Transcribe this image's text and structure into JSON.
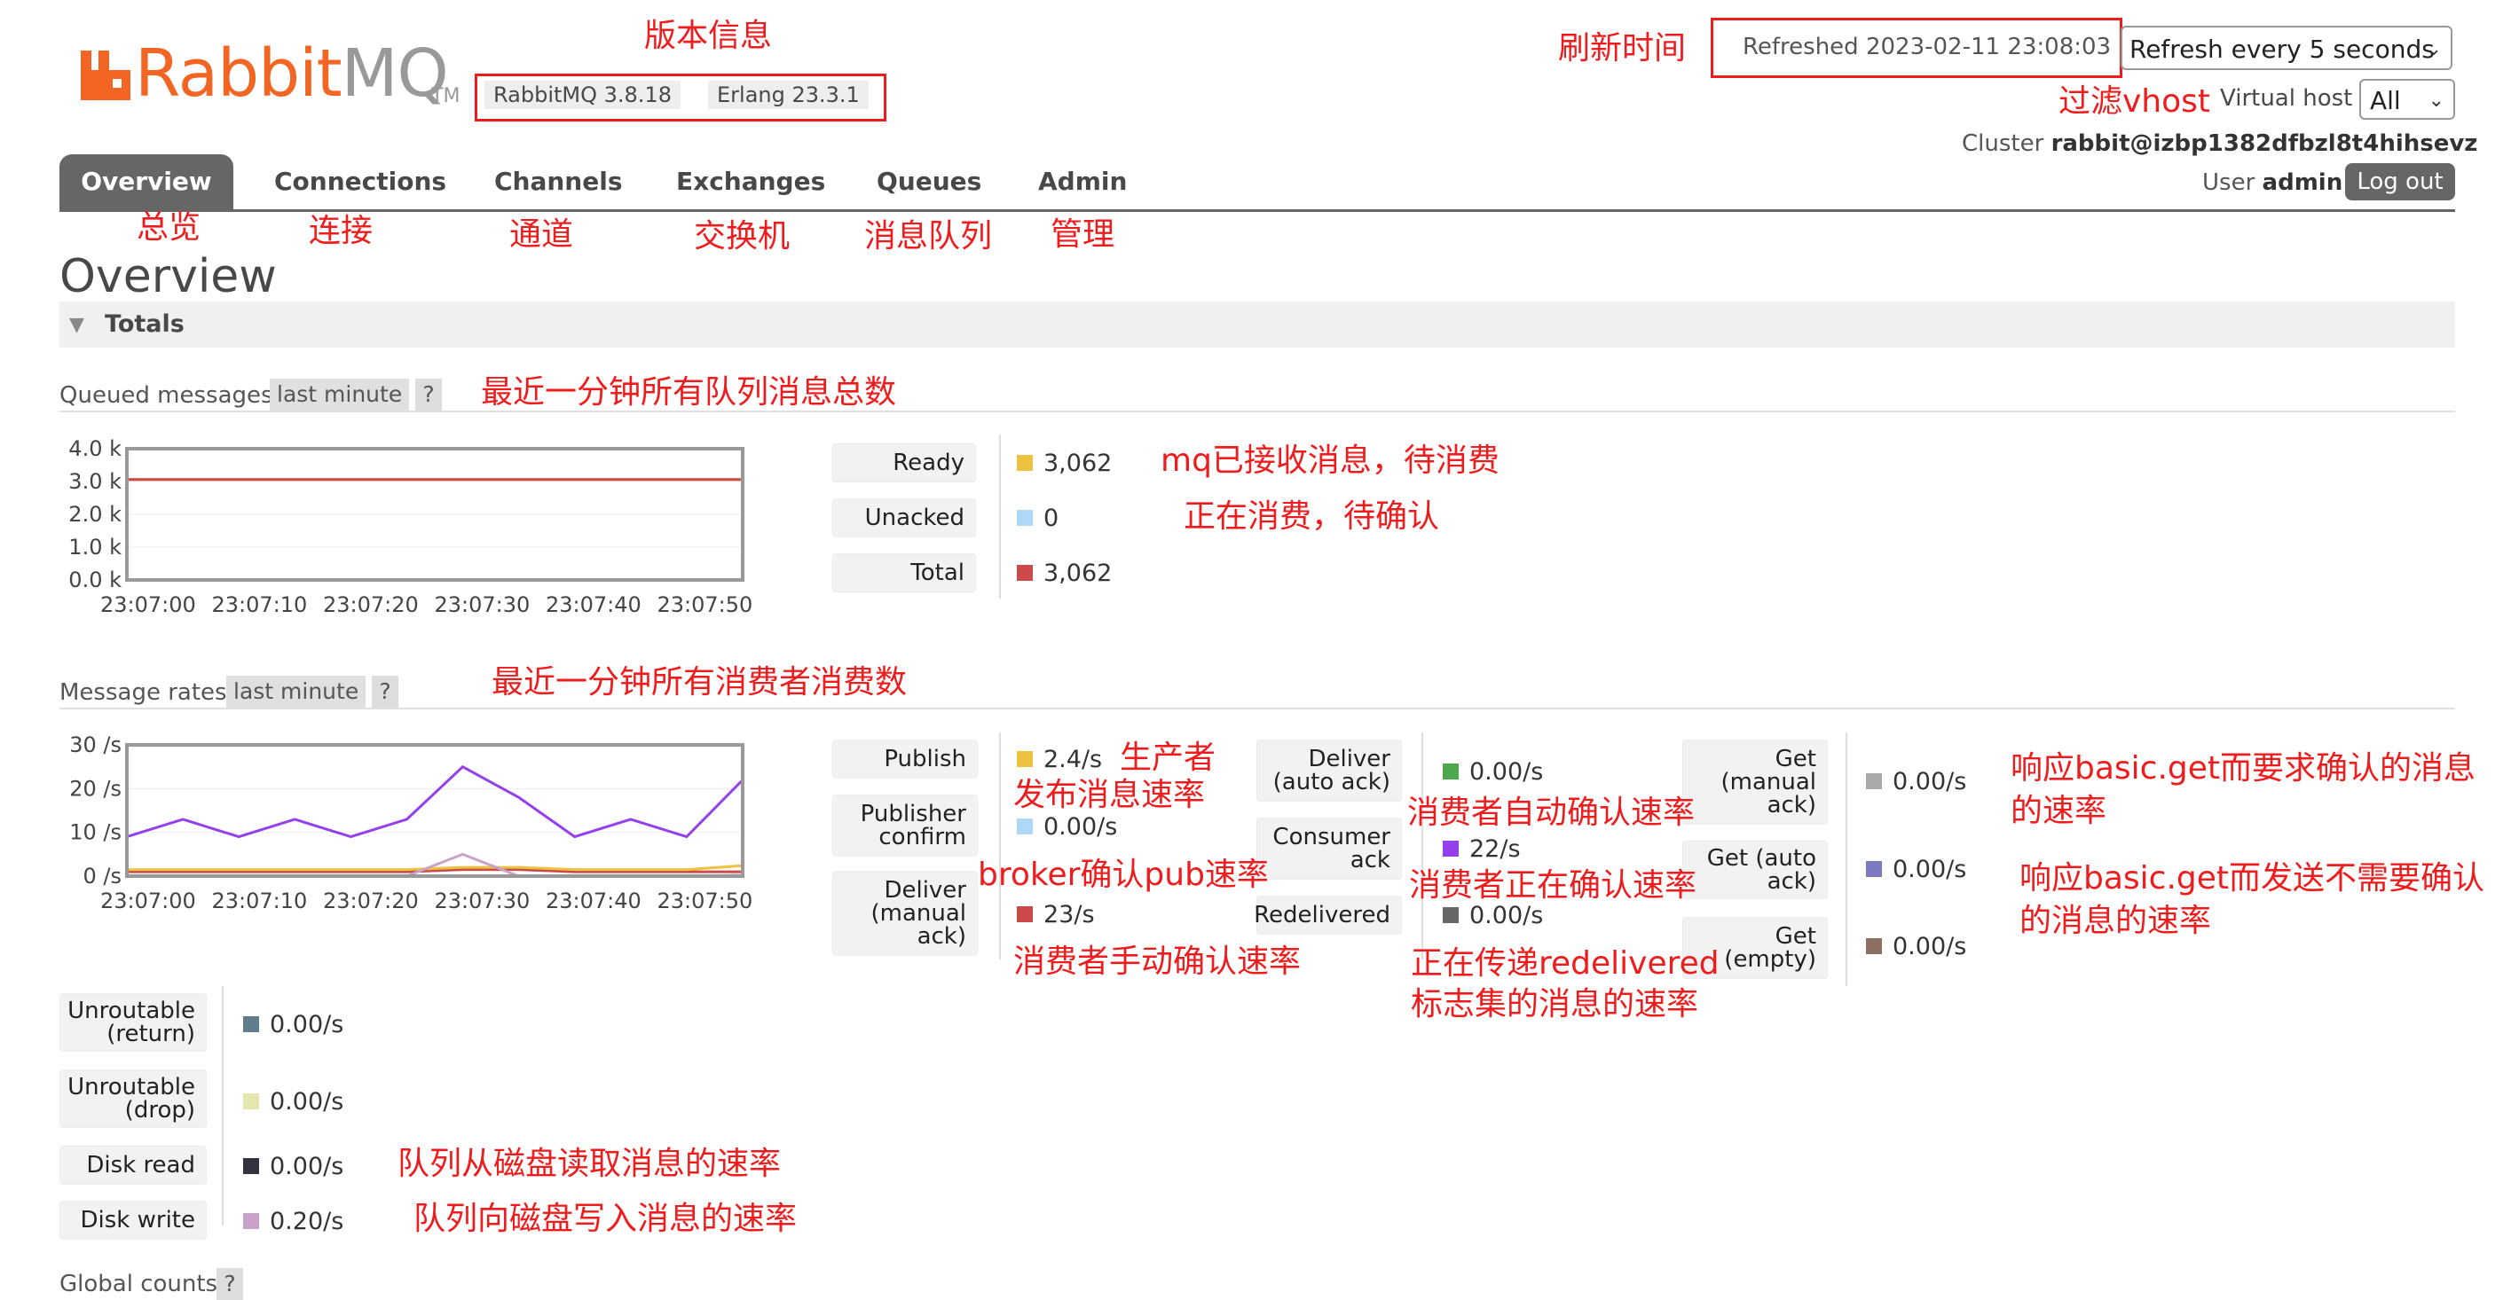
{
  "header": {
    "logo_rabbit": "Rabbit",
    "logo_mq": "MQ",
    "logo_tm": "TM",
    "rabbitmq_version": "RabbitMQ 3.8.18",
    "erlang_version": "Erlang 23.3.1",
    "refreshed": "Refreshed 2023-02-11 23:08:03",
    "refresh_option": "Refresh every 5 seconds",
    "vhost_label": "Virtual host",
    "vhost_value": "All",
    "cluster_label": "Cluster",
    "cluster_value": "rabbit@izbp1382dfbzl8t4hihsevz",
    "user_label": "User",
    "user_value": "admin",
    "logout": "Log out"
  },
  "tabs": [
    "Overview",
    "Connections",
    "Channels",
    "Exchanges",
    "Queues",
    "Admin"
  ],
  "page_title": "Overview",
  "totals_label": "Totals",
  "queued": {
    "label": "Queued messages",
    "range": "last minute",
    "help": "?",
    "rows": [
      {
        "label": "Ready",
        "value": "3,062",
        "color": "#edc240"
      },
      {
        "label": "Unacked",
        "value": "0",
        "color": "#afd8f8"
      },
      {
        "label": "Total",
        "value": "3,062",
        "color": "#cb4b4b"
      }
    ]
  },
  "rates": {
    "label": "Message rates",
    "range": "last minute",
    "help": "?",
    "col1": [
      {
        "label": "Publish",
        "value": "2.4/s",
        "color": "#edc240"
      },
      {
        "label": "Publisher confirm",
        "value": "0.00/s",
        "color": "#afd8f8"
      },
      {
        "label": "Deliver (manual ack)",
        "value": "23/s",
        "color": "#cb4b4b"
      }
    ],
    "col2": [
      {
        "label": "Deliver (auto ack)",
        "value": "0.00/s",
        "color": "#4da74d"
      },
      {
        "label": "Consumer ack",
        "value": "22/s",
        "color": "#9440ed"
      },
      {
        "label": "Redelivered",
        "value": "0.00/s",
        "color": "#666666"
      }
    ],
    "col3": [
      {
        "label": "Get (manual ack)",
        "value": "0.00/s",
        "color": "#aaaaaa"
      },
      {
        "label": "Get (auto ack)",
        "value": "0.00/s",
        "color": "#7c79c3"
      },
      {
        "label": "Get (empty)",
        "value": "0.00/s",
        "color": "#8d6e63"
      }
    ],
    "col4": [
      {
        "label": "Unroutable (return)",
        "value": "0.00/s",
        "color": "#607d8b"
      },
      {
        "label": "Unroutable (drop)",
        "value": "0.00/s",
        "color": "#e6e6b0"
      },
      {
        "label": "Disk read",
        "value": "0.00/s",
        "color": "#333340"
      },
      {
        "label": "Disk write",
        "value": "0.20/s",
        "color": "#c8a2c8"
      }
    ]
  },
  "global_counts": {
    "label": "Global counts",
    "help": "?"
  },
  "annotations": {
    "version_info": "版本信息",
    "refresh_time": "刷新时间",
    "filter_vhost": "过滤vhost",
    "tab_overview": "总览",
    "tab_connections": "连接",
    "tab_channels": "通道",
    "tab_exchanges": "交换机",
    "tab_queues": "消息队列",
    "tab_admin": "管理",
    "queued_total": "最近一分钟所有队列消息总数",
    "ready": "mq已接收消息，待消费",
    "unacked": "正在消费，待确认",
    "rates_total": "最近一分钟所有消费者消费数",
    "producer_1": "生产者",
    "producer_2": "发布消息速率",
    "broker_confirm": "broker确认pub速率",
    "manual_ack": "消费者手动确认速率",
    "auto_ack": "消费者自动确认速率",
    "consumer_ack": "消费者正在确认速率",
    "redelivered_1": "正在传递redelivered",
    "redelivered_2": "标志集的消息的速率",
    "get_manual_1": "响应basic.get而要求确认的消息",
    "get_manual_2": "的速率",
    "get_auto_1": "响应basic.get而发送不需要确认",
    "get_auto_2": "的消息的速率",
    "disk_read": "队列从磁盘读取消息的速率",
    "disk_write": "队列向磁盘写入消息的速率"
  },
  "chart_data": [
    {
      "type": "line",
      "title": "Queued messages",
      "x": [
        "23:07:00",
        "23:07:10",
        "23:07:20",
        "23:07:30",
        "23:07:40",
        "23:07:50"
      ],
      "yticks": [
        "4.0 k",
        "3.0 k",
        "2.0 k",
        "1.0 k",
        "0.0 k"
      ],
      "ylim": [
        0,
        4000
      ],
      "series": [
        {
          "name": "Ready",
          "color": "#edc240",
          "values": [
            3062,
            3062,
            3062,
            3062,
            3062,
            3062,
            3062
          ]
        },
        {
          "name": "Unacked",
          "color": "#afd8f8",
          "values": [
            0,
            0,
            0,
            0,
            0,
            0,
            0
          ]
        },
        {
          "name": "Total",
          "color": "#cb4b4b",
          "values": [
            3062,
            3062,
            3062,
            3062,
            3062,
            3062,
            3062
          ]
        }
      ]
    },
    {
      "type": "line",
      "title": "Message rates",
      "x": [
        "23:07:00",
        "23:07:10",
        "23:07:20",
        "23:07:30",
        "23:07:40",
        "23:07:50"
      ],
      "yticks": [
        "30 /s",
        "20 /s",
        "10 /s",
        "0 /s"
      ],
      "ylim": [
        0,
        30
      ],
      "series": [
        {
          "name": "Consumer ack",
          "color": "#9440ed",
          "values": [
            9,
            13,
            9,
            13,
            9,
            13,
            25,
            18,
            9,
            13,
            9,
            22
          ]
        },
        {
          "name": "Deliver (manual ack)",
          "color": "#cb4b4b",
          "values": [
            1,
            1,
            1,
            1,
            1,
            1,
            1.5,
            1.5,
            1,
            1,
            1,
            1
          ]
        },
        {
          "name": "Publish",
          "color": "#edc240",
          "values": [
            1.5,
            1.5,
            1.5,
            1.5,
            1.5,
            1.5,
            2,
            2,
            1.5,
            1.5,
            1.5,
            2.4
          ]
        },
        {
          "name": "Disk write",
          "color": "#c8a2c8",
          "values": [
            0,
            0,
            0,
            0,
            0,
            0,
            5,
            0,
            0,
            0,
            0,
            0.2
          ]
        }
      ]
    }
  ]
}
